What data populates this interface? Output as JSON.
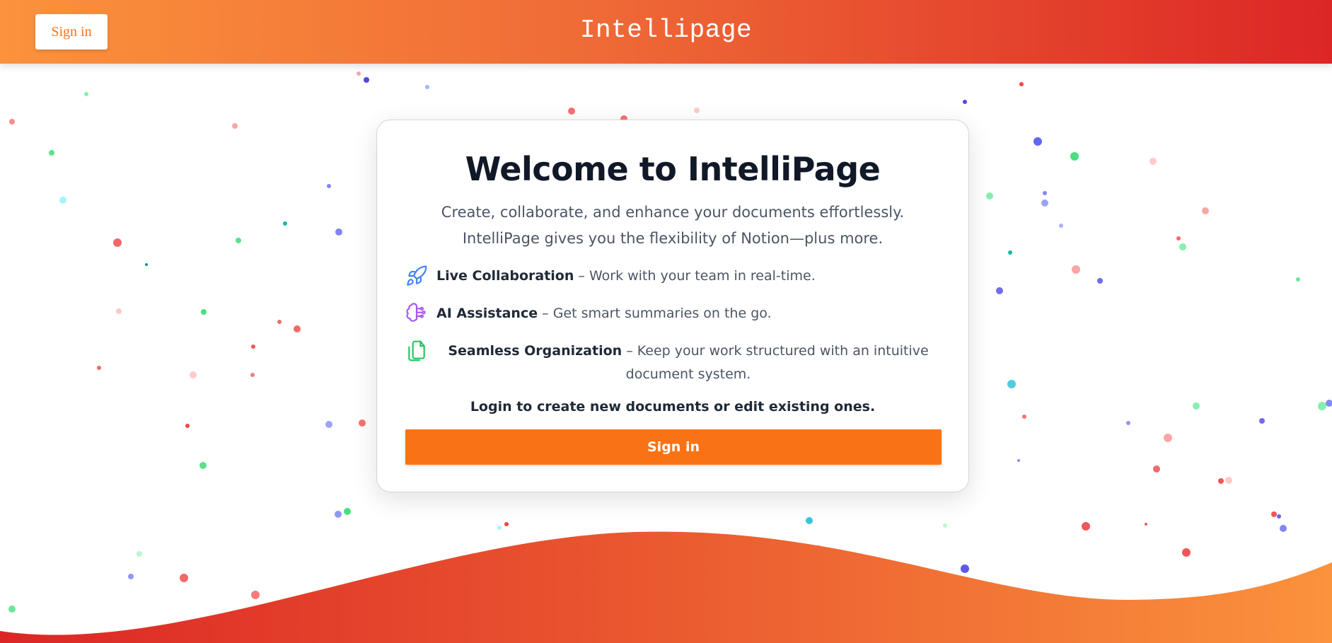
{
  "header": {
    "signin_label": "Sign in",
    "brand": "Intellipage"
  },
  "card": {
    "title": "Welcome to IntelliPage",
    "subtitle": "Create, collaborate, and enhance your documents effortlessly. IntelliPage gives you the flexibility of Notion—plus more.",
    "features": [
      {
        "icon": "rocket-icon",
        "name": "Live Collaboration",
        "desc": " – Work with your team in real-time."
      },
      {
        "icon": "brain-icon",
        "name": "AI Assistance",
        "desc": " – Get smart summaries on the go."
      },
      {
        "icon": "documents-icon",
        "name": "Seamless Organization",
        "desc": " – Keep your work structured with an intuitive document system."
      }
    ],
    "cta_text": "Login to create new documents or edit existing ones.",
    "signin_label": "Sign in"
  },
  "colors": {
    "accent": "#f97316",
    "header_gradient_start": "#fb923c",
    "header_gradient_end": "#dc2626",
    "title": "#111827",
    "icon_rocket": "#3b82f6",
    "icon_brain": "#a855f7",
    "icon_docs": "#22c55e"
  }
}
